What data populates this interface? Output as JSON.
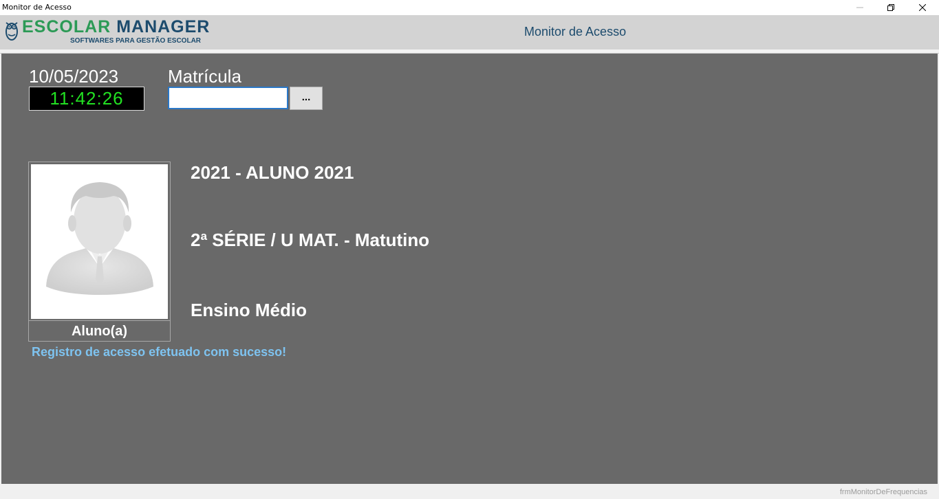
{
  "window": {
    "title": "Monitor de Acesso",
    "minimize_icon": "minimize-icon",
    "restore_icon": "restore-icon",
    "close_icon": "close-icon"
  },
  "header": {
    "logo": {
      "brand_part1": "ESCOLAR",
      "brand_part2": "MANAGER",
      "tagline": "SOFTWARES PARA GESTÃO ESCOLAR",
      "icon": "owl-icon"
    },
    "title": "Monitor de Acesso"
  },
  "main": {
    "date": "10/05/2023",
    "time": "11:42:26",
    "matricula": {
      "label": "Matrícula",
      "value": "",
      "browse_label": "..."
    },
    "student": {
      "photo_label": "Aluno(a)",
      "name": "2021 - ALUNO 2021",
      "class": "2ª SÉRIE / U MAT. - Matutino",
      "level": "Ensino Médio"
    },
    "message": "Registro de acesso efetuado com sucesso!"
  },
  "statusbar": {
    "form_name": "frmMonitorDeFrequencias"
  },
  "colors": {
    "background": "#696969",
    "header": "#d3d3d3",
    "clock_text": "#22e022",
    "message": "#7ec3f0",
    "brand_green": "#2c9a56",
    "brand_blue": "#1c4b6d"
  }
}
